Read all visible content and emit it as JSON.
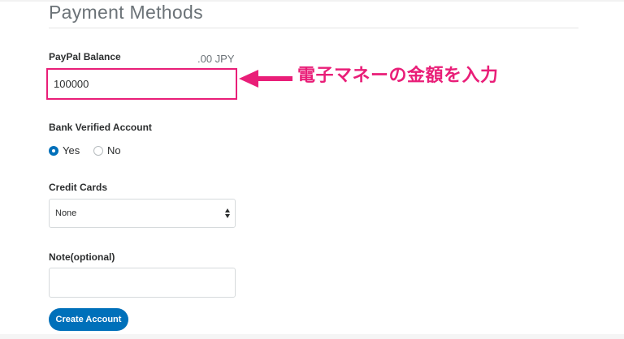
{
  "page": {
    "title": "Payment Methods"
  },
  "paypal_balance": {
    "label": "PayPal Balance",
    "currency_suffix": ".00 JPY",
    "value": "100000"
  },
  "annotation": {
    "text": "電子マネーの金額を入力",
    "color": "#e91e78"
  },
  "bank_verified": {
    "label": "Bank Verified Account",
    "options": [
      {
        "label": "Yes",
        "selected": true
      },
      {
        "label": "No",
        "selected": false
      }
    ]
  },
  "credit_cards": {
    "label": "Credit Cards",
    "selected": "None"
  },
  "note": {
    "label": "Note(optional)",
    "value": ""
  },
  "actions": {
    "create_label": "Create Account"
  },
  "colors": {
    "primary": "#0070ba",
    "highlight": "#e91e78",
    "text": "#2c2e2f",
    "muted": "#6c7378"
  }
}
